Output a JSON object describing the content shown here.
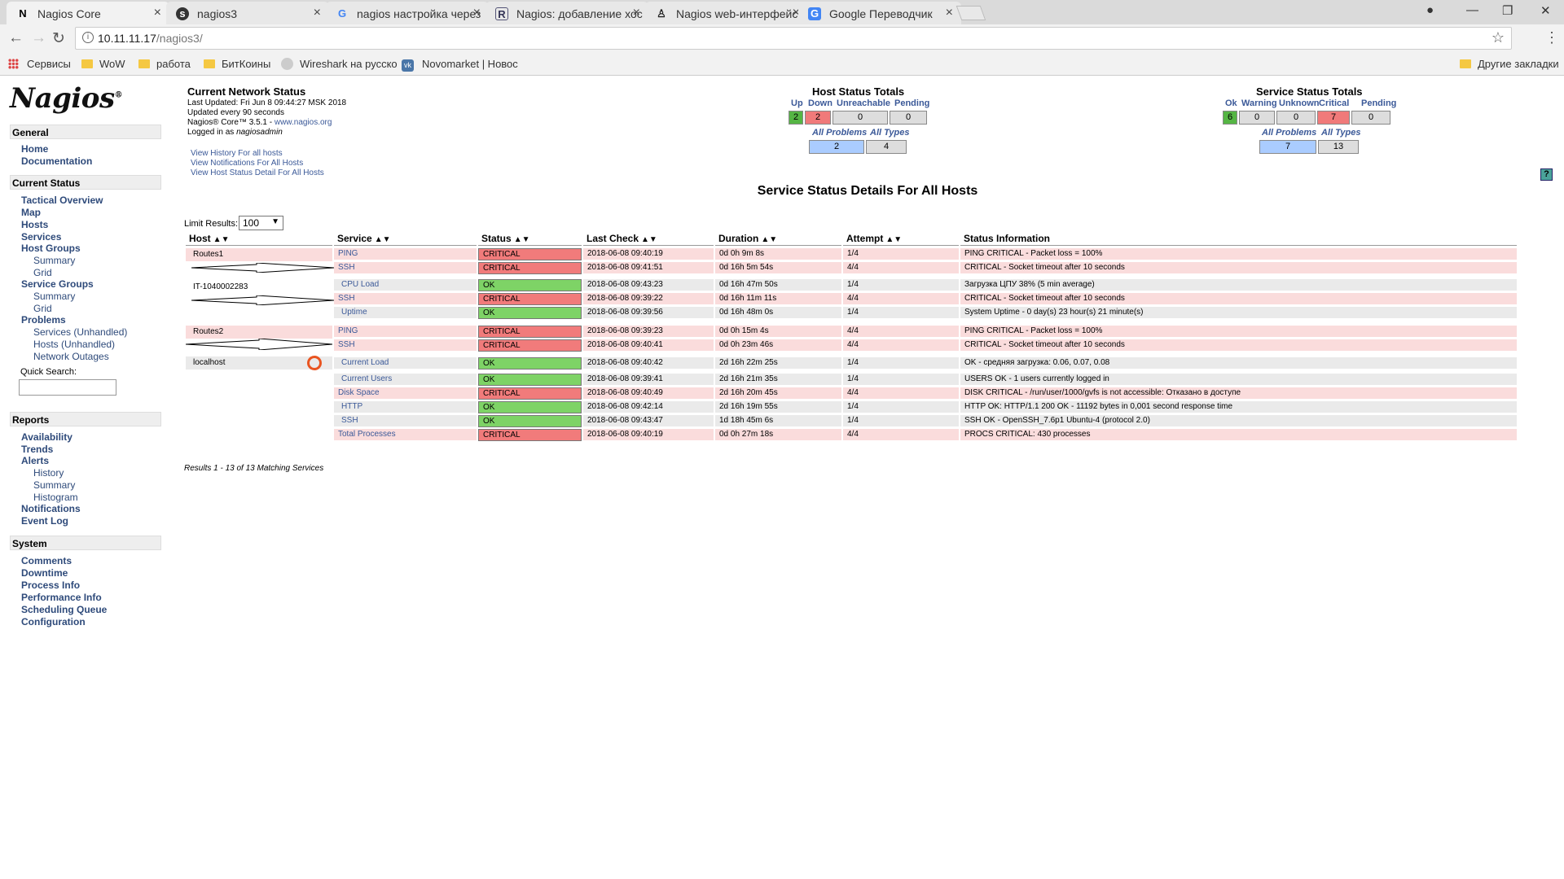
{
  "browser": {
    "tabs": [
      {
        "title": "Nagios Core",
        "icon": "nagios-favicon"
      },
      {
        "title": "nagios3",
        "icon": "habr-favicon"
      },
      {
        "title": "nagios настройка через",
        "icon": "google-favicon"
      },
      {
        "title": "Nagios: добавление хос",
        "icon": "r-favicon"
      },
      {
        "title": "Nagios web-интерфейс",
        "icon": "linux-penguin-favicon"
      },
      {
        "title": "Google Переводчик",
        "icon": "translate-favicon"
      }
    ],
    "url_host": "10.11.11.17",
    "url_path": "/nagios3/",
    "bookmarks": [
      "Сервисы",
      "WoW",
      "работа",
      "БитКоины",
      "Wireshark на русско",
      "Novomarket | Новос",
      "Другие закладки"
    ]
  },
  "sidebar": {
    "logo": "Nagios",
    "sections": {
      "general": {
        "title": "General",
        "links": [
          "Home",
          "Documentation"
        ]
      },
      "current_status": {
        "title": "Current Status",
        "tactical": "Tactical Overview",
        "map": "Map",
        "hosts": "Hosts",
        "services": "Services",
        "host_groups": "Host Groups",
        "hg_summary": "Summary",
        "hg_grid": "Grid",
        "service_groups": "Service Groups",
        "sg_summary": "Summary",
        "sg_grid": "Grid",
        "problems": "Problems",
        "services_unhandled": "Services (Unhandled)",
        "hosts_unhandled": "Hosts (Unhandled)",
        "network_outages": "Network Outages",
        "quick_search": "Quick Search:"
      },
      "reports": {
        "title": "Reports",
        "availability": "Availability",
        "trends": "Trends",
        "alerts": "Alerts",
        "history": "History",
        "summary": "Summary",
        "histogram": "Histogram",
        "notifications": "Notifications",
        "event_log": "Event Log"
      },
      "system": {
        "title": "System",
        "comments": "Comments",
        "downtime": "Downtime",
        "process_info": "Process Info",
        "performance_info": "Performance Info",
        "scheduling_queue": "Scheduling Queue",
        "configuration": "Configuration"
      }
    }
  },
  "info": {
    "title": "Current Network Status",
    "last_updated": "Last Updated: Fri Jun 8 09:44:27 MSK 2018",
    "update_interval": "Updated every 90 seconds",
    "version": "Nagios® Core™ 3.5.1 - ",
    "version_link": "www.nagios.org",
    "logged_in": "Logged in as ",
    "user": "nagiosadmin",
    "link_history": "View History For all hosts",
    "link_notifications": "View Notifications For All Hosts",
    "link_host_detail": "View Host Status Detail For All Hosts"
  },
  "host_totals": {
    "title": "Host Status Totals",
    "headers": [
      "Up",
      "Down",
      "Unreachable",
      "Pending"
    ],
    "values": [
      "2",
      "2",
      "0",
      "0"
    ],
    "all_problems_label": "All Problems",
    "all_types_label": "All Types",
    "all_problems": "2",
    "all_types": "4"
  },
  "service_totals": {
    "title": "Service Status Totals",
    "headers": [
      "Ok",
      "Warning",
      "Unknown",
      "Critical",
      "Pending"
    ],
    "values": [
      "6",
      "0",
      "0",
      "7",
      "0"
    ],
    "all_problems_label": "All Problems",
    "all_types_label": "All Types",
    "all_problems": "7",
    "all_types": "13"
  },
  "main": {
    "title": "Service Status Details For All Hosts",
    "limit_label": "Limit Results:",
    "limit_value": "100",
    "columns": [
      "Host",
      "Service",
      "Status",
      "Last Check",
      "Duration",
      "Attempt",
      "Status Information"
    ],
    "results": "Results 1 - 13 of 13 Matching Services"
  },
  "hosts": [
    "Routes1",
    "IT-1040002283",
    "Routes2",
    "localhost"
  ],
  "rows": [
    {
      "service": "PING",
      "status": "CRITICAL",
      "last_check": "2018-06-08 09:40:19",
      "duration": "0d 0h 9m 8s",
      "attempt": "1/4",
      "info": "PING CRITICAL - Packet loss = 100%"
    },
    {
      "service": "SSH",
      "status": "CRITICAL",
      "last_check": "2018-06-08 09:41:51",
      "duration": "0d 16h 5m 54s",
      "attempt": "4/4",
      "info": "CRITICAL - Socket timeout after 10 seconds"
    },
    {
      "service": "CPU Load",
      "status": "OK",
      "last_check": "2018-06-08 09:43:23",
      "duration": "0d 16h 47m 50s",
      "attempt": "1/4",
      "info": "Загрузка ЦПУ 38% (5 min average)"
    },
    {
      "service": "SSH",
      "status": "CRITICAL",
      "last_check": "2018-06-08 09:39:22",
      "duration": "0d 16h 11m 11s",
      "attempt": "4/4",
      "info": "CRITICAL - Socket timeout after 10 seconds"
    },
    {
      "service": "Uptime",
      "status": "OK",
      "last_check": "2018-06-08 09:39:56",
      "duration": "0d 16h 48m 0s",
      "attempt": "1/4",
      "info": "System Uptime - 0 day(s) 23 hour(s) 21 minute(s)"
    },
    {
      "service": "PING",
      "status": "CRITICAL",
      "last_check": "2018-06-08 09:39:23",
      "duration": "0d 0h 15m 4s",
      "attempt": "4/4",
      "info": "PING CRITICAL - Packet loss = 100%"
    },
    {
      "service": "SSH",
      "status": "CRITICAL",
      "last_check": "2018-06-08 09:40:41",
      "duration": "0d 0h 23m 46s",
      "attempt": "4/4",
      "info": "CRITICAL - Socket timeout after 10 seconds"
    },
    {
      "service": "Current Load",
      "status": "OK",
      "last_check": "2018-06-08 09:40:42",
      "duration": "2d 16h 22m 25s",
      "attempt": "1/4",
      "info": "OK - средняя загрузка: 0.06, 0.07, 0.08"
    },
    {
      "service": "Current Users",
      "status": "OK",
      "last_check": "2018-06-08 09:39:41",
      "duration": "2d 16h 21m 35s",
      "attempt": "1/4",
      "info": "USERS OK - 1 users currently logged in"
    },
    {
      "service": "Disk Space",
      "status": "CRITICAL",
      "last_check": "2018-06-08 09:40:49",
      "duration": "2d 16h 20m 45s",
      "attempt": "4/4",
      "info": "DISK CRITICAL - /run/user/1000/gvfs is not accessible: Отказано в доступе"
    },
    {
      "service": "HTTP",
      "status": "OK",
      "last_check": "2018-06-08 09:42:14",
      "duration": "2d 16h 19m 55s",
      "attempt": "1/4",
      "info": "HTTP OK: HTTP/1.1 200 OK - 11192 bytes in 0,001 second response time"
    },
    {
      "service": "SSH",
      "status": "OK",
      "last_check": "2018-06-08 09:43:47",
      "duration": "1d 18h 45m 6s",
      "attempt": "1/4",
      "info": "SSH OK - OpenSSH_7.6p1 Ubuntu-4 (protocol 2.0)"
    },
    {
      "service": "Total Processes",
      "status": "CRITICAL",
      "last_check": "2018-06-08 09:40:19",
      "duration": "0d 0h 27m 18s",
      "attempt": "4/4",
      "info": "PROCS CRITICAL: 430 processes"
    }
  ]
}
